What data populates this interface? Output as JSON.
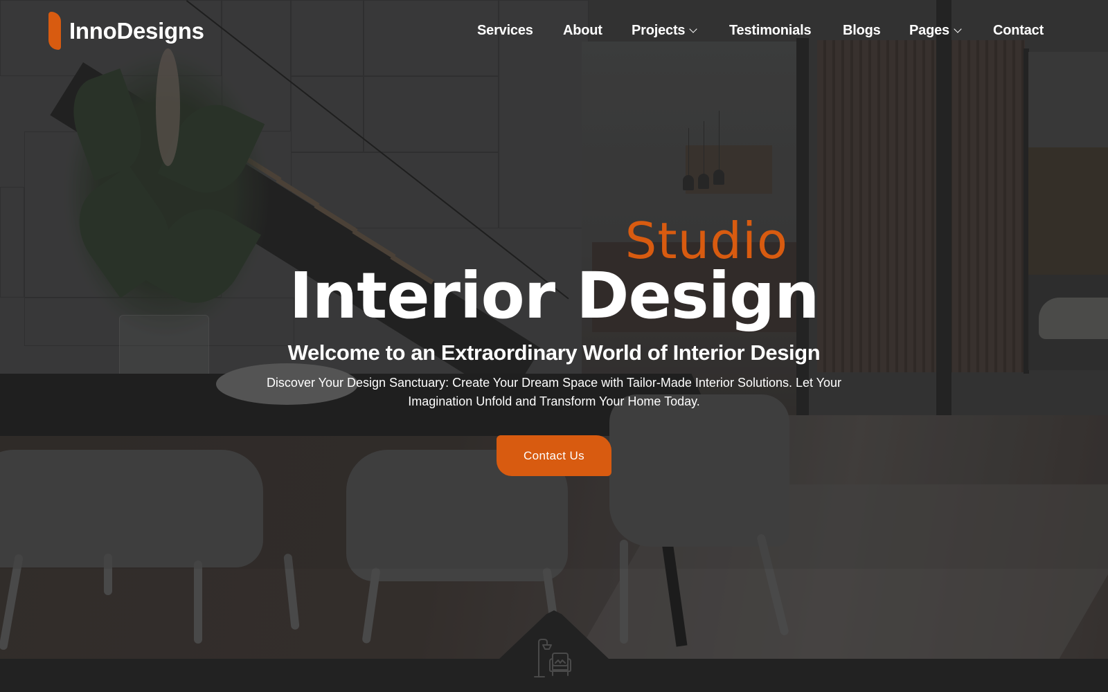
{
  "brand": {
    "name": "InnoDesigns",
    "accent_color": "#d85b10",
    "logo_icon": "leaf-mark-icon"
  },
  "nav": {
    "items": [
      {
        "label": "Services",
        "has_dropdown": false
      },
      {
        "label": "About",
        "has_dropdown": false
      },
      {
        "label": "Projects",
        "has_dropdown": true
      },
      {
        "label": "Testimonials",
        "has_dropdown": false
      },
      {
        "label": "Blogs",
        "has_dropdown": false
      },
      {
        "label": "Pages",
        "has_dropdown": true
      },
      {
        "label": "Contact",
        "has_dropdown": false
      }
    ],
    "dropdown_icon": "chevron-down-icon"
  },
  "hero": {
    "eyebrow": "Studio",
    "title": "Interior Design",
    "subtitle": "Welcome to an Extraordinary World of Interior Design",
    "description": "Discover Your Design Sanctuary: Create Your Dream Space with Tailor-Made Interior Solutions. Let Your Imagination Unfold and Transform Your Home Today.",
    "cta_label": "Contact Us",
    "background": "dining-room-interior-photo"
  },
  "section_divider": {
    "icon": "floor-lamp-armchair-icon"
  },
  "colors": {
    "accent": "#d85b10",
    "text": "#ffffff",
    "dark_band": "#222222"
  }
}
